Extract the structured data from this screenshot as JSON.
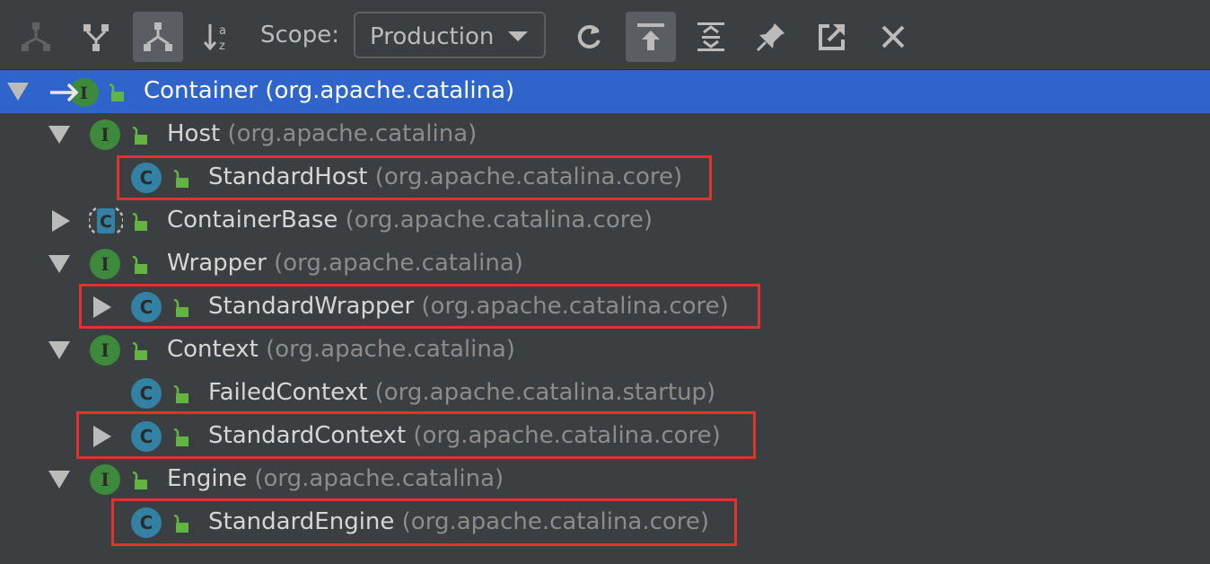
{
  "toolbar": {
    "scope_label": "Scope:",
    "scope_value": "Production",
    "buttons": [
      {
        "name": "supertypes-hierarchy-icon"
      },
      {
        "name": "subtypes-hierarchy-icon"
      },
      {
        "name": "class-hierarchy-icon",
        "active": true
      },
      {
        "name": "sort-alphabetically-icon"
      },
      {
        "name": "refresh-icon"
      },
      {
        "name": "autoscroll-from-source-icon",
        "active": true
      },
      {
        "name": "expand-all-icon"
      },
      {
        "name": "pin-tab-icon"
      },
      {
        "name": "export-icon"
      },
      {
        "name": "close-icon"
      }
    ]
  },
  "tree": [
    {
      "name": "Container",
      "pkg": "(org.apache.catalina)",
      "kind": "interface",
      "expanded": true,
      "selected": true
    },
    {
      "name": "Host",
      "pkg": "(org.apache.catalina)",
      "kind": "interface",
      "expanded": true
    },
    {
      "name": "StandardHost",
      "pkg": "(org.apache.catalina.core)",
      "kind": "class",
      "highlighted": true
    },
    {
      "name": "ContainerBase",
      "pkg": "(org.apache.catalina.core)",
      "kind": "abstract-class",
      "expanded": false
    },
    {
      "name": "Wrapper",
      "pkg": "(org.apache.catalina)",
      "kind": "interface",
      "expanded": true
    },
    {
      "name": "StandardWrapper",
      "pkg": "(org.apache.catalina.core)",
      "kind": "class",
      "expanded": false,
      "highlighted": true
    },
    {
      "name": "Context",
      "pkg": "(org.apache.catalina)",
      "kind": "interface",
      "expanded": true
    },
    {
      "name": "FailedContext",
      "pkg": "(org.apache.catalina.startup)",
      "kind": "class"
    },
    {
      "name": "StandardContext",
      "pkg": "(org.apache.catalina.core)",
      "kind": "class",
      "expanded": false,
      "highlighted": true
    },
    {
      "name": "Engine",
      "pkg": "(org.apache.catalina)",
      "kind": "interface",
      "expanded": true
    },
    {
      "name": "StandardEngine",
      "pkg": "(org.apache.catalina.core)",
      "kind": "class",
      "highlighted": true
    }
  ],
  "colors": {
    "background": "#3c3f41",
    "selection": "#2f65ca",
    "highlight_border": "#e0332b",
    "interface_icon": "#3e8a3d",
    "class_icon": "#3382a3"
  }
}
